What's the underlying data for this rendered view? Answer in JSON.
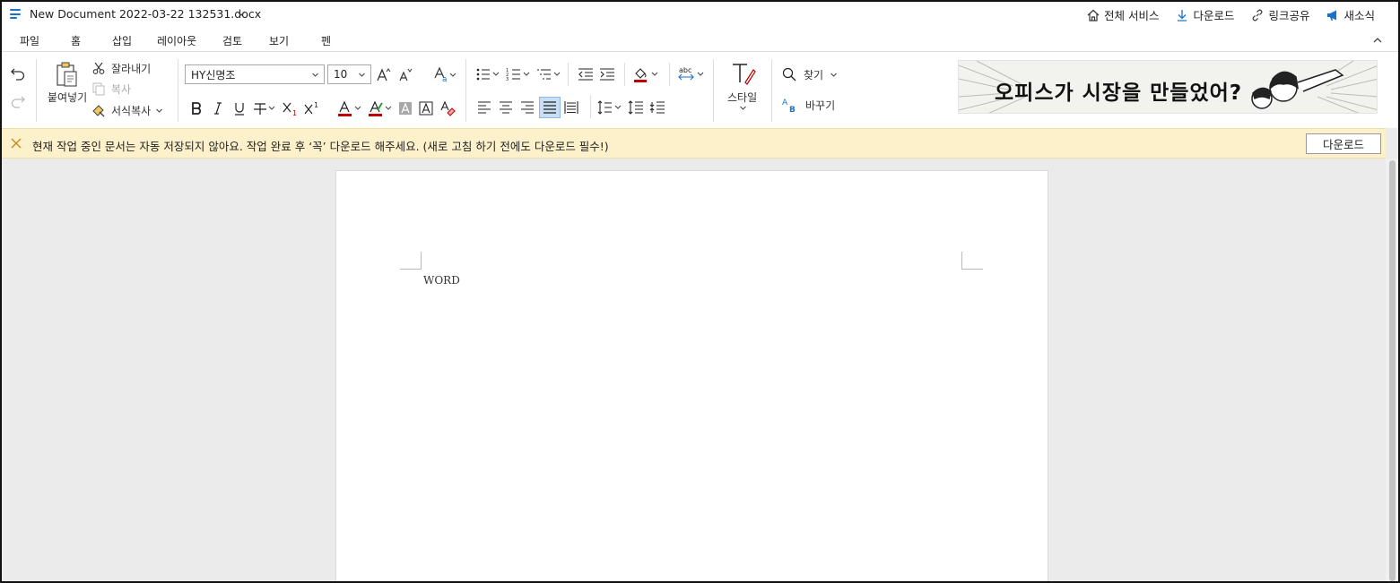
{
  "titlebar": {
    "doc_title": "New Document 2022-03-22 132531.docx",
    "actions": [
      {
        "label": "전체 서비스",
        "icon": "home-icon"
      },
      {
        "label": "다운로드",
        "icon": "download-icon"
      },
      {
        "label": "링크공유",
        "icon": "link-icon"
      },
      {
        "label": "새소식",
        "icon": "megaphone-icon"
      }
    ]
  },
  "tabs": [
    "파일",
    "홈",
    "삽입",
    "레이아웃",
    "검토",
    "보기",
    "펜"
  ],
  "active_tab": "홈",
  "ribbon": {
    "paste_label": "붙여넣기",
    "cut_label": "잘라내기",
    "copy_label": "복사",
    "format_painter_label": "서식복사",
    "font_name": "HY신명조",
    "font_size": "10",
    "style_label": "스타일",
    "find_label": "찾기",
    "replace_label": "바꾸기",
    "ad_text": "오피스가 시장을 만들었어?"
  },
  "notice": {
    "text": "현재 작업 중인 문서는 자동 저장되지 않아요. 작업 완료 후 ‘꼭’ 다운로드 해주세요. (새로 고침 하기 전에도 다운로드 필수!)",
    "button": "다운로드"
  },
  "document": {
    "content": "WORD"
  },
  "colors": {
    "accent": "#1a73c9",
    "notice_bg": "#fdf1cc",
    "font_color": "#c00000",
    "highlight": "#c00000"
  }
}
